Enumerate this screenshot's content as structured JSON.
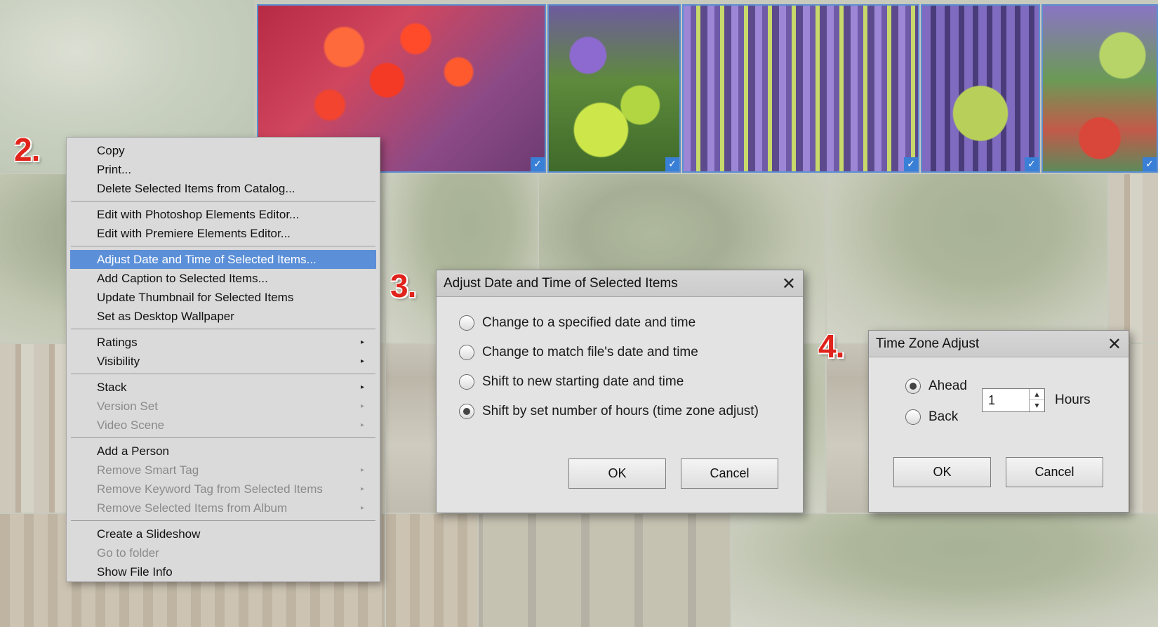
{
  "steps": {
    "two": "2.",
    "three": "3.",
    "four": "4."
  },
  "context_menu": {
    "groups": [
      [
        {
          "label": "Copy",
          "enabled": true
        },
        {
          "label": "Print...",
          "enabled": true
        },
        {
          "label": "Delete Selected Items from Catalog...",
          "enabled": true
        }
      ],
      [
        {
          "label": "Edit with Photoshop Elements Editor...",
          "enabled": true
        },
        {
          "label": "Edit with Premiere Elements Editor...",
          "enabled": true
        }
      ],
      [
        {
          "label": "Adjust Date and Time of Selected Items...",
          "enabled": true,
          "highlighted": true
        },
        {
          "label": "Add Caption to Selected Items...",
          "enabled": true
        },
        {
          "label": "Update Thumbnail for Selected Items",
          "enabled": true
        },
        {
          "label": "Set as Desktop Wallpaper",
          "enabled": true
        }
      ],
      [
        {
          "label": "Ratings",
          "enabled": true,
          "submenu": true
        },
        {
          "label": "Visibility",
          "enabled": true,
          "submenu": true
        }
      ],
      [
        {
          "label": "Stack",
          "enabled": true,
          "submenu": true
        },
        {
          "label": "Version Set",
          "enabled": false,
          "submenu": true
        },
        {
          "label": "Video Scene",
          "enabled": false,
          "submenu": true
        }
      ],
      [
        {
          "label": "Add a Person",
          "enabled": true
        },
        {
          "label": "Remove Smart Tag",
          "enabled": false,
          "submenu": true
        },
        {
          "label": "Remove Keyword Tag from Selected Items",
          "enabled": false,
          "submenu": true
        },
        {
          "label": "Remove Selected Items from Album",
          "enabled": false,
          "submenu": true
        }
      ],
      [
        {
          "label": "Create a Slideshow",
          "enabled": true
        },
        {
          "label": "Go to folder",
          "enabled": false
        },
        {
          "label": "Show File Info",
          "enabled": true
        }
      ]
    ]
  },
  "adjust_dialog": {
    "title": "Adjust Date and Time of Selected Items",
    "options": [
      {
        "label": "Change to a specified date and time",
        "selected": false
      },
      {
        "label": "Change to match file's date and time",
        "selected": false
      },
      {
        "label": "Shift to new starting date and time",
        "selected": false
      },
      {
        "label": "Shift by set number of hours (time zone adjust)",
        "selected": true
      }
    ],
    "ok_label": "OK",
    "cancel_label": "Cancel"
  },
  "timezone_dialog": {
    "title": "Time Zone Adjust",
    "ahead_label": "Ahead",
    "back_label": "Back",
    "ahead_selected": true,
    "hours_value": "1",
    "hours_label": "Hours",
    "ok_label": "OK",
    "cancel_label": "Cancel"
  },
  "colors": {
    "selection_blue": "#5b8fd8",
    "step_red": "#e0241c",
    "check_blue": "#3a7fd6"
  }
}
